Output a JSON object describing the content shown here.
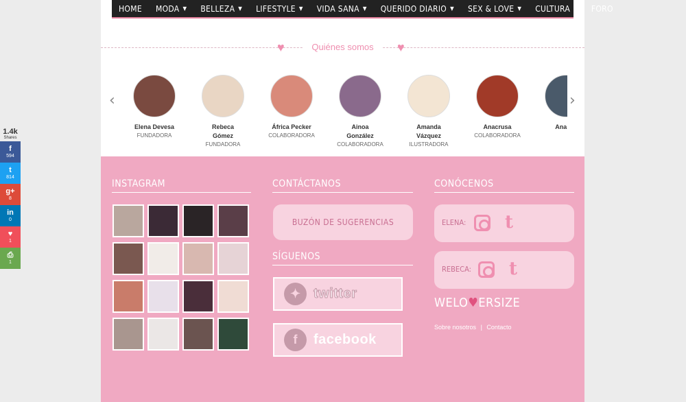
{
  "nav": [
    {
      "label": "HOME",
      "dropdown": false
    },
    {
      "label": "MODA",
      "dropdown": true
    },
    {
      "label": "BELLEZA",
      "dropdown": true
    },
    {
      "label": "LIFESTYLE",
      "dropdown": true
    },
    {
      "label": "VIDA SANA",
      "dropdown": true
    },
    {
      "label": "QUERIDO DIARIO",
      "dropdown": true
    },
    {
      "label": "SEX & LOVE",
      "dropdown": true
    },
    {
      "label": "CULTURA",
      "dropdown": true
    },
    {
      "label": "FORO",
      "dropdown": false
    }
  ],
  "about": {
    "title": "Quiénes somos",
    "members": [
      {
        "name": "Elena Devesa",
        "role": "FUNDADORA",
        "color": "#7a4a40"
      },
      {
        "name": "Rebeca Gómez",
        "role": "FUNDADORA",
        "color": "#e9d6c4"
      },
      {
        "name": "África Pecker",
        "role": "COLABORADORA",
        "color": "#d98a7a"
      },
      {
        "name": "Ainoa González",
        "role": "COLABORADORA",
        "color": "#8a6a8c"
      },
      {
        "name": "Amanda Vázquez",
        "role": "ILUSTRADORA",
        "color": "#f3e5d3"
      },
      {
        "name": "Anacrusa",
        "role": "COLABORADORA",
        "color": "#a13a28"
      },
      {
        "name": "Ana Ga",
        "role": "",
        "color": "#4a5a6a"
      }
    ]
  },
  "instagram": {
    "title": "INSTAGRAM",
    "thumbs": [
      "#b9a79e",
      "#3b2a36",
      "#2a2426",
      "#5a3e48",
      "#7a5850",
      "#f1ece8",
      "#d8b8b0",
      "#e6d3d6",
      "#c97c6a",
      "#e8e0ea",
      "#4a2e3a",
      "#f0dcd4",
      "#a9968f",
      "#ebe7e6",
      "#6b5450",
      "#2f4a3a"
    ]
  },
  "contact": {
    "title": "CONTÁCTANOS",
    "suggestions_button": "BUZÓN DE SUGERENCIAS",
    "follow_title": "SÍGUENOS",
    "twitter_label": "twitter",
    "facebook_label": "facebook"
  },
  "meet": {
    "title": "CONÓCENOS",
    "elena_label": "ELENA:",
    "rebeca_label": "REBECA:",
    "logo_pre": "WELO",
    "logo_post": "ERSIZE",
    "links": [
      "Sobre nosotros",
      "|",
      "Contacto"
    ]
  },
  "share": {
    "count": "1.4k",
    "label": "Shares",
    "buttons": [
      {
        "icon": "f",
        "count": "594",
        "color": "#3b5998"
      },
      {
        "icon": "t",
        "count": "814",
        "color": "#1da1f2"
      },
      {
        "icon": "g+",
        "count": "8",
        "color": "#dd4b39"
      },
      {
        "icon": "in",
        "count": "0",
        "color": "#0077b5"
      },
      {
        "icon": "♥",
        "count": "1",
        "color": "#f04f5a"
      },
      {
        "icon": "⎙",
        "count": "1",
        "color": "#6aa84f"
      }
    ]
  }
}
